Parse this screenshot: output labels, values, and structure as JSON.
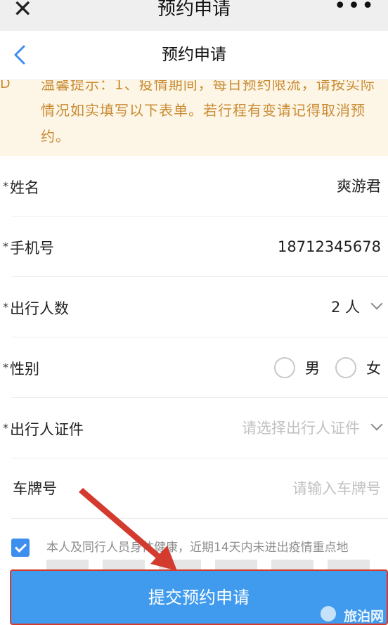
{
  "wx": {
    "close_icon": "✕",
    "title": "预约申请",
    "more": "•••"
  },
  "header": {
    "title": "预约申请",
    "back_icon": "chevron-left-icon"
  },
  "notice": {
    "icon_text": "Ⅾ",
    "text": "温馨提示：1、疫情期间，每日预约限流，请按实际情况如实填写以下表单。若行程有变请记得取消预约。"
  },
  "form": {
    "name": {
      "label": "姓名",
      "value": "爽游君",
      "required": true
    },
    "phone": {
      "label": "手机号",
      "value": "18712345678",
      "required": true
    },
    "people": {
      "label": "出行人数",
      "value": "2 人",
      "required": true
    },
    "gender": {
      "label": "性别",
      "options": [
        "男",
        "女"
      ],
      "required": true
    },
    "id_doc": {
      "label": "出行人证件",
      "placeholder": "请选择出行人证件",
      "required": true
    },
    "plate": {
      "label": "车牌号",
      "placeholder": "请输入车牌号",
      "required": false
    },
    "required_mark": "*"
  },
  "agreement": {
    "checked": true,
    "text": "本人及同行人员身体健康，近期14天内未进出疫情重点地"
  },
  "submit": {
    "label": "提交预约申请"
  },
  "watermark": "旅泊网",
  "colors": {
    "accent": "#409bee",
    "notice_bg": "#fdf6e6",
    "notice_text": "#c98b33",
    "arrow": "#d33b2f"
  }
}
